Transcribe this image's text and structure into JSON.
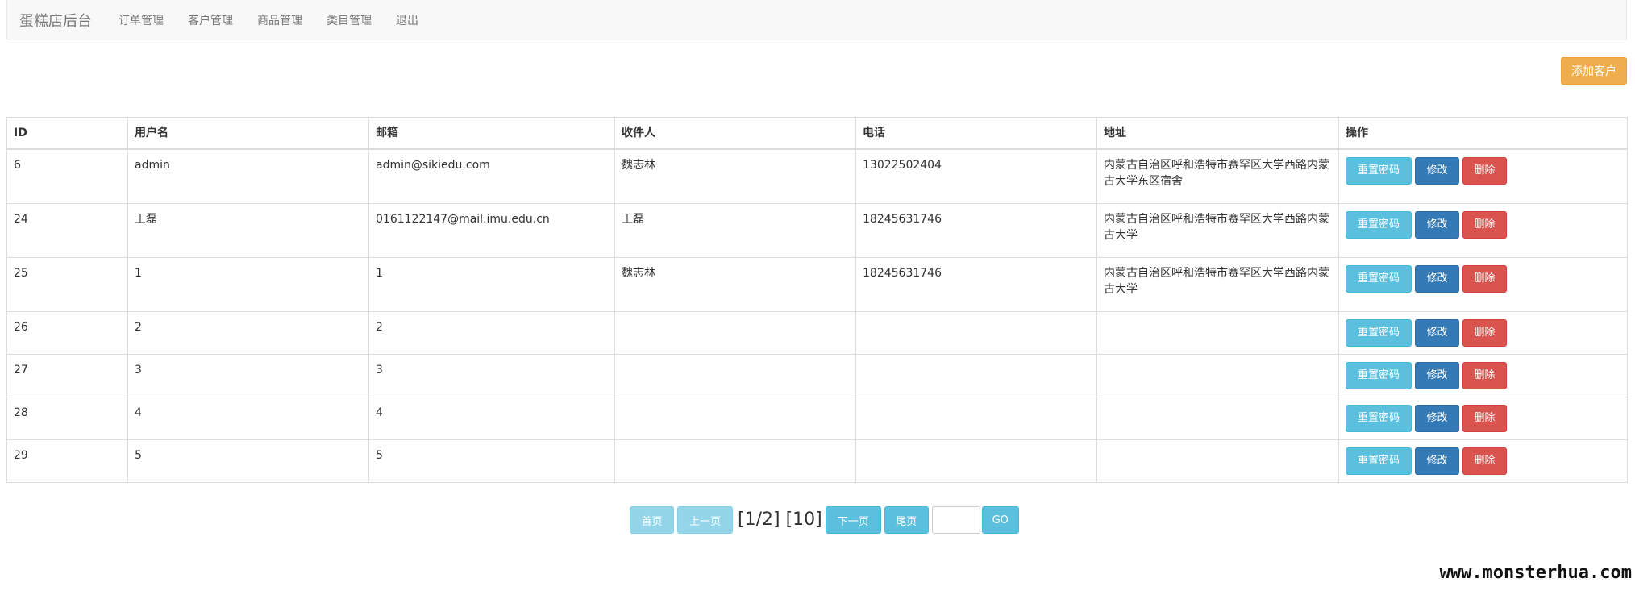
{
  "navbar": {
    "brand": "蛋糕店后台",
    "links": [
      "订单管理",
      "客户管理",
      "商品管理",
      "类目管理",
      "退出"
    ]
  },
  "add_button_label": "添加客户",
  "table": {
    "headers": [
      "ID",
      "用户名",
      "邮箱",
      "收件人",
      "电话",
      "地址",
      "操作"
    ],
    "rows": [
      [
        "6",
        "admin",
        "admin@sikiedu.com",
        "魏志林",
        "13022502404",
        "内蒙古自治区呼和浩特市赛罕区大学西路内蒙古大学东区宿舍"
      ],
      [
        "24",
        "王磊",
        "0161122147@mail.imu.edu.cn",
        "王磊",
        "18245631746",
        "内蒙古自治区呼和浩特市赛罕区大学西路内蒙古大学"
      ],
      [
        "25",
        "1",
        "1",
        "魏志林",
        "18245631746",
        "内蒙古自治区呼和浩特市赛罕区大学西路内蒙古大学"
      ],
      [
        "26",
        "2",
        "2",
        "",
        "",
        ""
      ],
      [
        "27",
        "3",
        "3",
        "",
        "",
        ""
      ],
      [
        "28",
        "4",
        "4",
        "",
        "",
        ""
      ],
      [
        "29",
        "5",
        "5",
        "",
        "",
        ""
      ]
    ],
    "actions": {
      "reset": "重置密码",
      "edit": "修改",
      "delete": "删除"
    }
  },
  "pagination": {
    "first": "首页",
    "prev": "上一页",
    "info": "[1/2] [10]",
    "next": "下一页",
    "last": "尾页",
    "input_value": "",
    "go": "GO"
  },
  "watermark": "www.monsterhua.com",
  "colors": {
    "warning": "#f0ad4e",
    "info": "#5bc0de",
    "primary": "#337ab7",
    "danger": "#d9534f"
  }
}
